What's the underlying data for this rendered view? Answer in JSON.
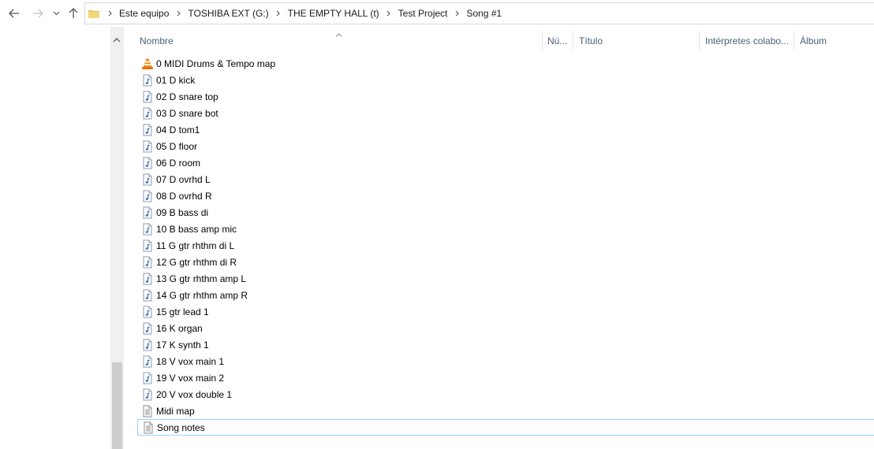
{
  "breadcrumbs": [
    "Este equipo",
    "TOSHIBA EXT (G:)",
    "THE EMPTY HALL (t)",
    "Test Project",
    "Song #1"
  ],
  "columns": {
    "name": "Nombre",
    "number": "Nú...",
    "title": "Título",
    "artists": "Intérpretes colabo...",
    "album": "Álbum"
  },
  "files": [
    {
      "name": "0 MIDI Drums & Tempo map",
      "icon": "vlc-cone-icon"
    },
    {
      "name": "01 D kick",
      "icon": "audio-file-icon"
    },
    {
      "name": "02 D snare top",
      "icon": "audio-file-icon"
    },
    {
      "name": "03 D snare bot",
      "icon": "audio-file-icon"
    },
    {
      "name": "04 D tom1",
      "icon": "audio-file-icon"
    },
    {
      "name": "05 D floor",
      "icon": "audio-file-icon"
    },
    {
      "name": "06 D room",
      "icon": "audio-file-icon"
    },
    {
      "name": "07 D ovrhd L",
      "icon": "audio-file-icon"
    },
    {
      "name": "08 D ovrhd R",
      "icon": "audio-file-icon"
    },
    {
      "name": "09 B bass di",
      "icon": "audio-file-icon"
    },
    {
      "name": "10 B bass amp mic",
      "icon": "audio-file-icon"
    },
    {
      "name": "11 G gtr rhthm di L",
      "icon": "audio-file-icon"
    },
    {
      "name": "12 G gtr rhthm di R",
      "icon": "audio-file-icon"
    },
    {
      "name": "13 G gtr rhthm amp L",
      "icon": "audio-file-icon"
    },
    {
      "name": "14 G gtr rhthm amp R",
      "icon": "audio-file-icon"
    },
    {
      "name": "15 gtr lead 1",
      "icon": "audio-file-icon"
    },
    {
      "name": "16 K organ",
      "icon": "audio-file-icon"
    },
    {
      "name": "17 K synth 1",
      "icon": "audio-file-icon"
    },
    {
      "name": "18 V vox main 1",
      "icon": "audio-file-icon"
    },
    {
      "name": "19 V vox main 2",
      "icon": "audio-file-icon"
    },
    {
      "name": "20 V vox double 1",
      "icon": "audio-file-icon"
    },
    {
      "name": "Midi map",
      "icon": "text-file-icon"
    },
    {
      "name": "Song notes",
      "icon": "text-file-icon",
      "selected": true
    }
  ],
  "colors": {
    "header_text": "#4c607a",
    "selection_border": "#99d1ff",
    "folder": "#e8c15a"
  }
}
